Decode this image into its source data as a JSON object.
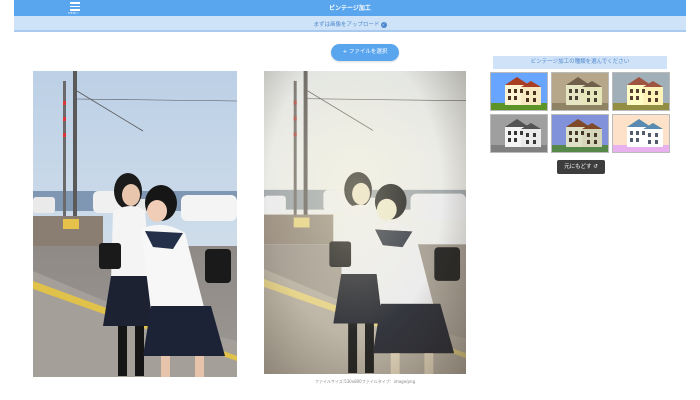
{
  "header": {
    "menu_label": "MENU",
    "title": "ビンテージ加工"
  },
  "upload_notice": {
    "text": "まずは画像をアップロード",
    "check_icon": "check-circle-icon"
  },
  "file_button": {
    "label": "+ ファイルを選択"
  },
  "file_info": {
    "text": "ファイルサイズ:530x800ファイルタイプ：image/png"
  },
  "filters": {
    "heading": "ビンテージ加工の種類を選んでください",
    "thumbnails": [
      {
        "name": "vivid"
      },
      {
        "name": "sepia"
      },
      {
        "name": "warm"
      },
      {
        "name": "monochrome"
      },
      {
        "name": "cool"
      },
      {
        "name": "bright"
      }
    ]
  },
  "reset_button": {
    "label": "元にもどす",
    "icon": "undo-icon"
  },
  "colors": {
    "accent": "#5aa6ee",
    "notice_bg": "#cfe3f8",
    "notice_text": "#4d88cf",
    "dark_button": "#3d3d3d"
  }
}
